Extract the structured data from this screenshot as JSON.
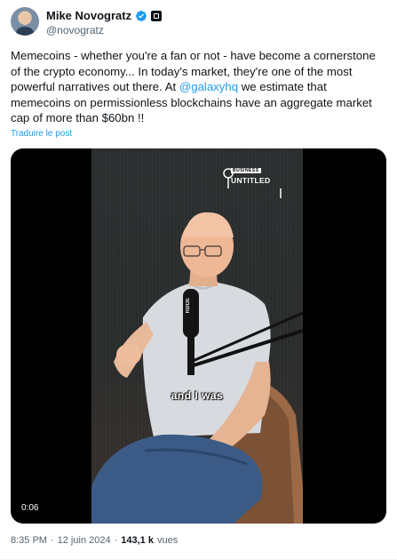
{
  "author": {
    "name": "Mike Novogratz",
    "handle": "@novogratz"
  },
  "tweet": {
    "text_before_mention": "Memecoins - whether you're a fan or not - have become a cornerstone of the crypto economy... In today's market, they're one of the most powerful narratives out there. At ",
    "mention": "@galaxyhq",
    "text_after_mention": " we estimate that memecoins on permissionless blockchains have an aggregate market cap of more than $60bn !!",
    "translate_label": "Traduire le post"
  },
  "video": {
    "duration": "0:06",
    "caption": "and I was",
    "logo_small": "BUSINESS",
    "logo_main": "UNTITLED",
    "mic_label": "RØDE"
  },
  "meta": {
    "time": "8:35 PM",
    "separator": "·",
    "date": "12 juin 2024",
    "views_count": "143,1 k",
    "views_label": "vues"
  },
  "colors": {
    "link": "#1d9bf0",
    "verified": "#1d9bf0",
    "secondary_text": "#536471"
  },
  "icons": [
    "verified-badge-icon",
    "organization-badge-icon",
    "lightbulb-logo-icon"
  ]
}
